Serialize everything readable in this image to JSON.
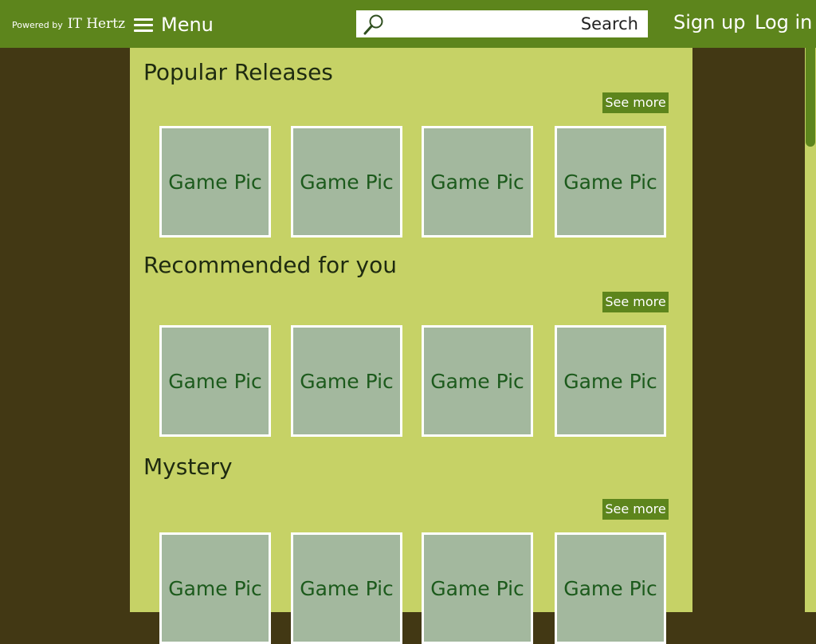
{
  "header": {
    "powered_by": "Powered by",
    "brand": "IT Hertz",
    "menu_label": "Menu",
    "search_button": "Search",
    "search_placeholder": "",
    "signup": "Sign up",
    "login": "Log in"
  },
  "sections": [
    {
      "title": "Popular Releases",
      "see_more": "See more",
      "tiles": [
        "Game Pic",
        "Game Pic",
        "Game Pic",
        "Game Pic"
      ]
    },
    {
      "title": "Recommended for you",
      "see_more": "See more",
      "tiles": [
        "Game Pic",
        "Game Pic",
        "Game Pic",
        "Game Pic"
      ]
    },
    {
      "title": "Mystery",
      "see_more": "See more",
      "tiles": [
        "Game Pic",
        "Game Pic",
        "Game Pic",
        "Game Pic"
      ]
    }
  ],
  "colors": {
    "header_bg": "#5d851c",
    "page_bg": "#423814",
    "content_bg": "#c6d266",
    "tile_bg": "#a3b89e",
    "tile_text": "#1c5a1c",
    "button_bg": "#5d851c"
  }
}
